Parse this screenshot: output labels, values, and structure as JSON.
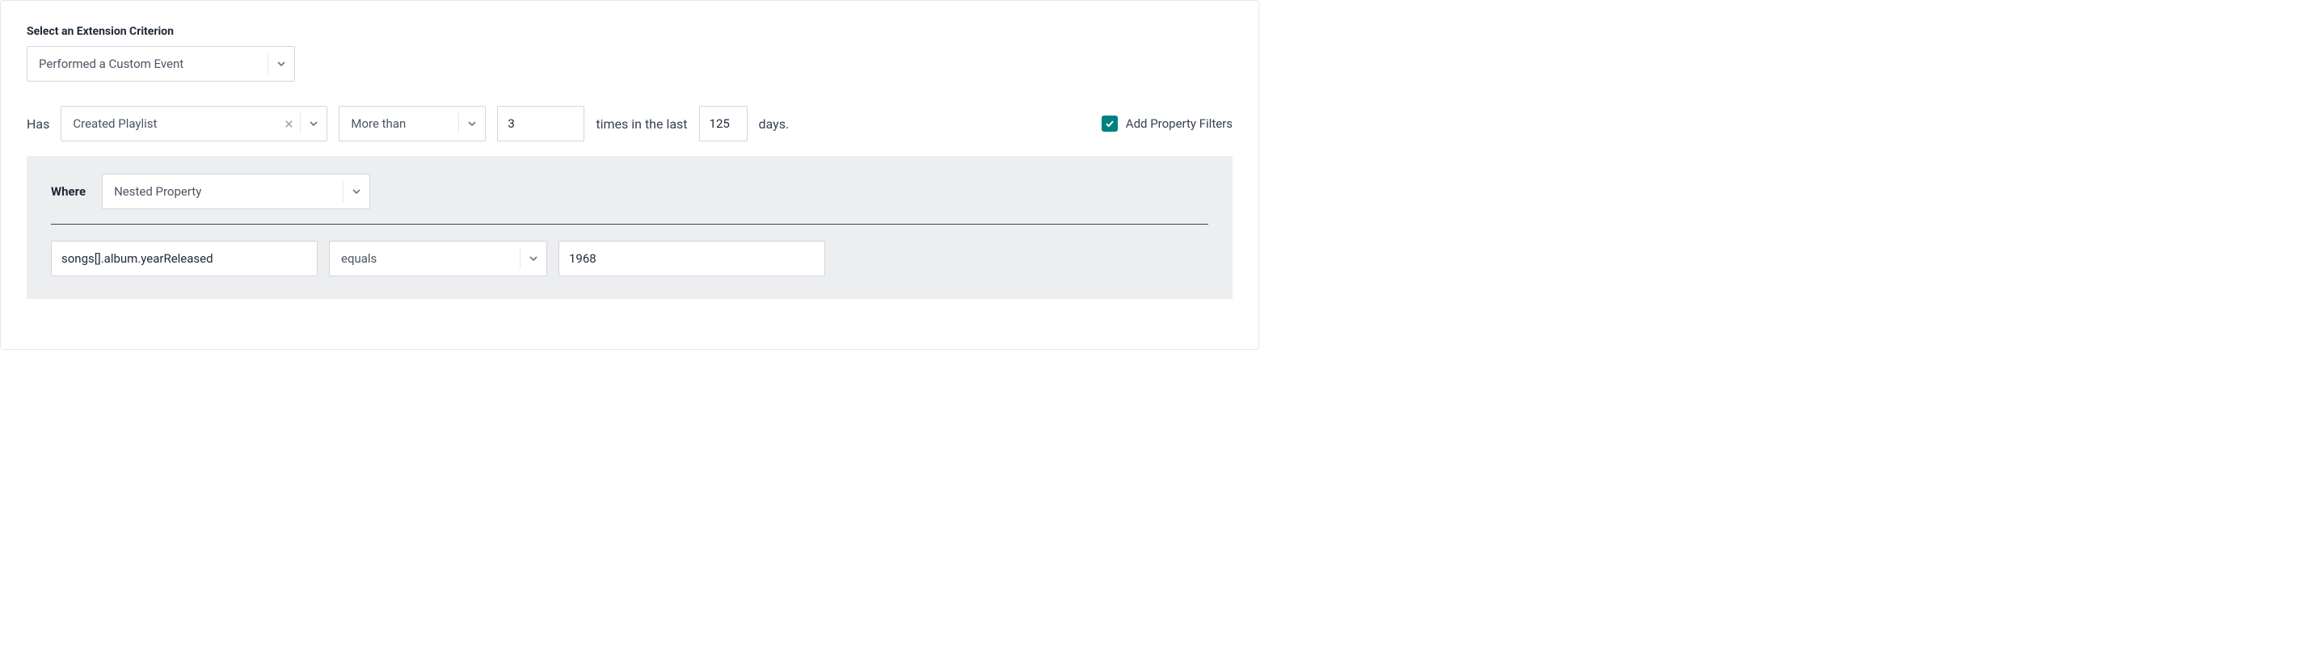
{
  "criterion": {
    "label": "Select an Extension Criterion",
    "value": "Performed a Custom Event"
  },
  "has_row": {
    "prefix": "Has",
    "event": "Created Playlist",
    "comparator": "More than",
    "count": "3",
    "mid_text": "times in the last",
    "days": "125",
    "suffix": "days."
  },
  "add_filters": {
    "label": "Add Property Filters",
    "checked": true
  },
  "where": {
    "label": "Where",
    "type": "Nested Property"
  },
  "filter": {
    "property": "songs[].album.yearReleased",
    "operator": "equals",
    "value": "1968"
  }
}
